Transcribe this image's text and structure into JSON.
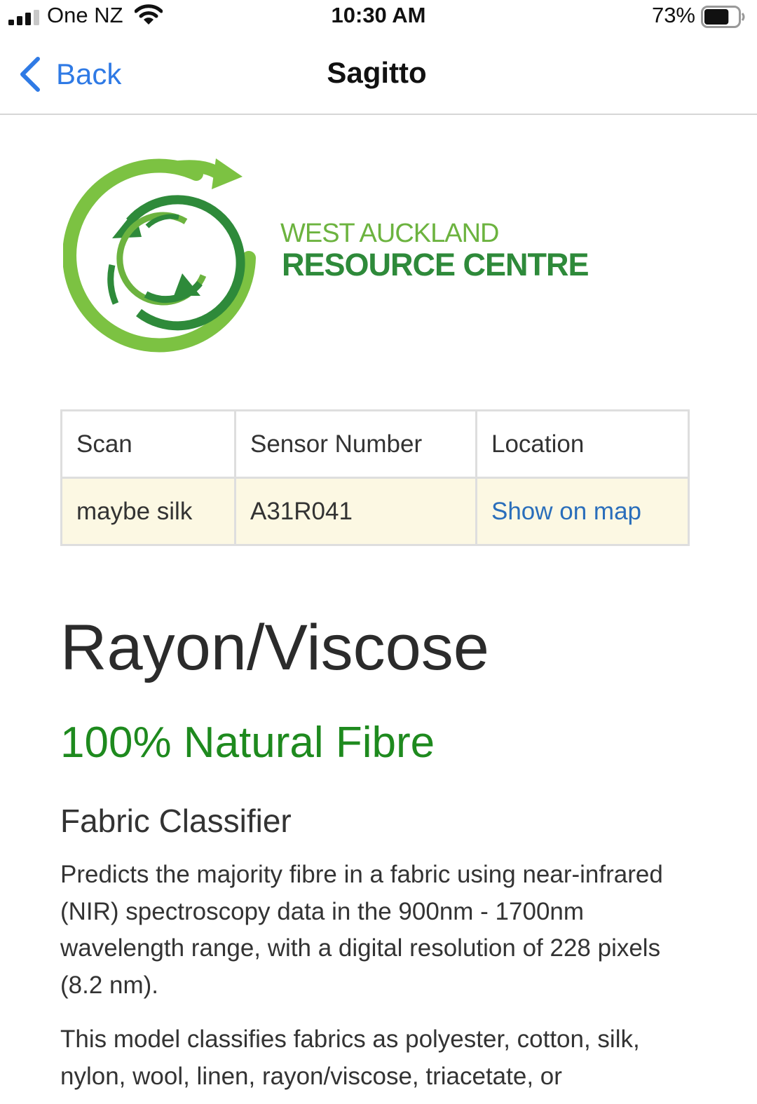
{
  "status_bar": {
    "carrier": "One NZ",
    "time": "10:30 AM",
    "battery": "73%",
    "battery_level": 0.73
  },
  "nav": {
    "back_label": "Back",
    "title": "Sagitto"
  },
  "logo": {
    "line1": "WEST AUCKLAND",
    "line2": "RESOURCE CENTRE",
    "colors": {
      "light_green": "#6cb33f",
      "dark_green": "#2e8a3a"
    }
  },
  "table": {
    "headers": [
      "Scan",
      "Sensor Number",
      "Location"
    ],
    "row": {
      "scan": "maybe silk",
      "sensor_number": "A31R041",
      "location_link": "Show on map"
    }
  },
  "result": {
    "title": "Rayon/Viscose",
    "subtitle": "100% Natural Fibre",
    "subtitle_color": "#1e8a1e"
  },
  "classifier": {
    "heading": "Fabric Classifier",
    "paragraph1": "Predicts the majority fibre in a fabric using near-infrared (NIR) spectroscopy data in the 900nm - 1700nm wavelength range, with a digital resolution of 228 pixels (8.2 nm).",
    "paragraph2": "This model classifies fabrics as polyester, cotton, silk, nylon, wool, linen, rayon/viscose, triacetate, or"
  }
}
